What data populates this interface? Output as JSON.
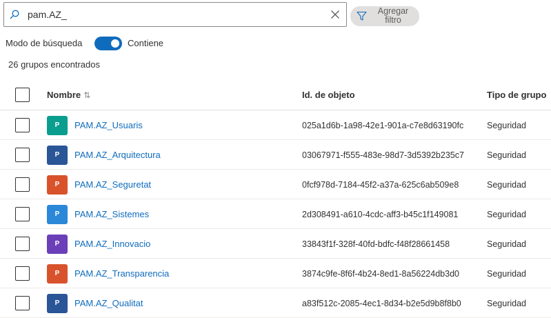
{
  "search": {
    "value": "pam.AZ_"
  },
  "filter_button": {
    "label": "Agregar filtro"
  },
  "search_mode": {
    "label": "Modo de búsqueda",
    "toggle_on": true,
    "value_label": "Contiene"
  },
  "results_count": "26 grupos encontrados",
  "columns": {
    "name": "Nombre",
    "object_id": "Id. de objeto",
    "group_type": "Tipo de grupo"
  },
  "rows": [
    {
      "avatar_letter": "P",
      "avatar_color": "#0a9e8f",
      "name": "PAM.AZ_Usuaris",
      "object_id": "025a1d6b-1a98-42e1-901a-c7e8d63190fc",
      "type": "Seguridad"
    },
    {
      "avatar_letter": "P",
      "avatar_color": "#2a5597",
      "name": "PAM.AZ_Arquitectura",
      "object_id": "03067971-f555-483e-98d7-3d5392b235c7",
      "type": "Seguridad"
    },
    {
      "avatar_letter": "P",
      "avatar_color": "#d8532c",
      "name": "PAM.AZ_Seguretat",
      "object_id": "0fcf978d-7184-45f2-a37a-625c6ab509e8",
      "type": "Seguridad"
    },
    {
      "avatar_letter": "P",
      "avatar_color": "#2b88d8",
      "name": "PAM.AZ_Sistemes",
      "object_id": "2d308491-a610-4cdc-aff3-b45c1f149081",
      "type": "Seguridad"
    },
    {
      "avatar_letter": "P",
      "avatar_color": "#6b3fb8",
      "name": "PAM.AZ_Innovacio",
      "object_id": "33843f1f-328f-40fd-bdfc-f48f28661458",
      "type": "Seguridad"
    },
    {
      "avatar_letter": "P",
      "avatar_color": "#d8532c",
      "name": "PAM.AZ_Transparencia",
      "object_id": "3874c9fe-8f6f-4b24-8ed1-8a56224db3d0",
      "type": "Seguridad"
    },
    {
      "avatar_letter": "P",
      "avatar_color": "#2a5597",
      "name": "PAM.AZ_Qualitat",
      "object_id": "a83f512c-2085-4ec1-8d34-b2e5d9b8f8b0",
      "type": "Seguridad"
    }
  ]
}
